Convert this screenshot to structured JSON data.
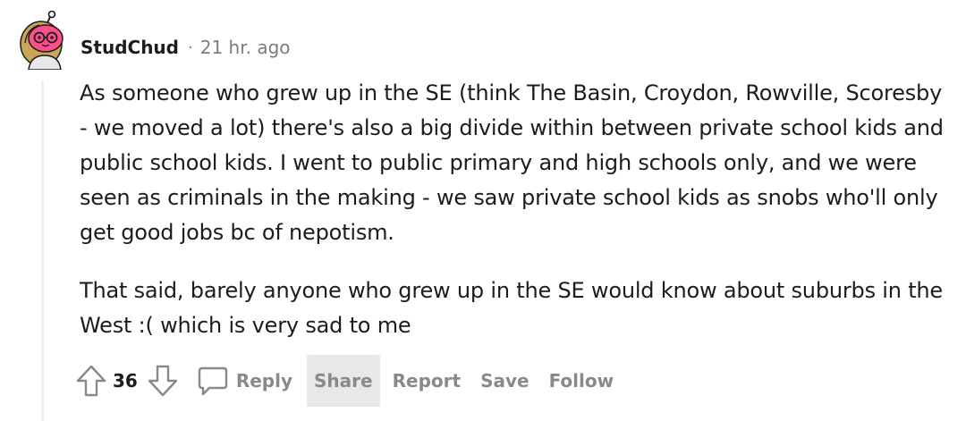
{
  "comment": {
    "author": "StudChud",
    "separator": "·",
    "timestamp": "21 hr. ago",
    "paragraphs": [
      "As someone who grew up in the SE (think The Basin, Croydon, Rowville, Scoresby - we moved a lot) there's also a big divide within between private school kids and public school kids. I went to public primary and high schools only, and we were seen as criminals in the making - we saw private school kids as snobs who'll only get good jobs bc of nepotism.",
      "That said, barely anyone who grew up in the SE would know about suburbs in the West :( which is very sad to me"
    ],
    "votes": "36",
    "actions": {
      "reply": "Reply",
      "share": "Share",
      "report": "Report",
      "save": "Save",
      "follow": "Follow"
    }
  },
  "icons": {
    "avatar": "snoo-avatar",
    "upvote": "upvote-arrow-icon",
    "downvote": "downvote-arrow-icon",
    "reply": "comment-bubble-icon"
  },
  "colors": {
    "text": "#1c1c1c",
    "muted": "#7c7c7c",
    "action": "#878a8c",
    "thread_line": "#edeff1",
    "hover_bg": "#e8e8e8"
  }
}
